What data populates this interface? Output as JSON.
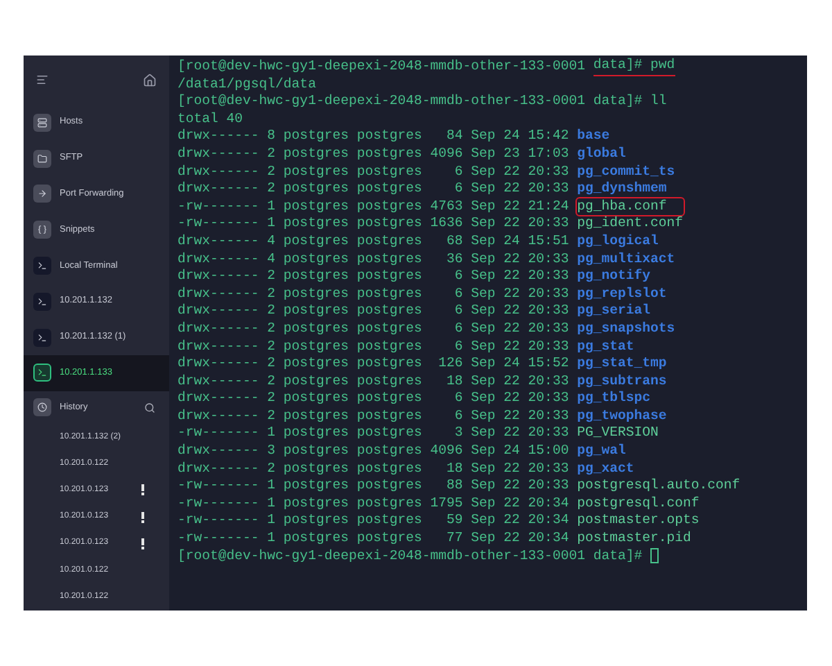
{
  "sidebar": {
    "nav": [
      {
        "label": "Hosts",
        "kind": "hosts",
        "selected": false
      },
      {
        "label": "SFTP",
        "kind": "sftp",
        "selected": false
      },
      {
        "label": "Port Forwarding",
        "kind": "forward",
        "selected": false
      },
      {
        "label": "Snippets",
        "kind": "snippets",
        "selected": false
      },
      {
        "label": "Local Terminal",
        "kind": "terminal",
        "selected": false
      },
      {
        "label": "10.201.1.132",
        "kind": "terminal",
        "selected": false
      },
      {
        "label": "10.201.1.132 (1)",
        "kind": "terminal",
        "selected": false
      },
      {
        "label": "10.201.1.133",
        "kind": "terminal",
        "selected": true
      }
    ],
    "history": {
      "label": "History",
      "items": [
        {
          "label": "10.201.1.132 (2)",
          "warning": false
        },
        {
          "label": "10.201.0.122",
          "warning": false
        },
        {
          "label": "10.201.0.123",
          "warning": true
        },
        {
          "label": "10.201.0.123",
          "warning": true
        },
        {
          "label": "10.201.0.123",
          "warning": true
        },
        {
          "label": "10.201.0.122",
          "warning": false
        },
        {
          "label": "10.201.0.122",
          "warning": false
        }
      ]
    }
  },
  "terminal": {
    "lines": [
      {
        "kind": "prompt",
        "user": "[root@dev-hwc-gy1-deepexi-2048-mmdb-other-133-0001",
        "dir": "data]#",
        "command": "pwd",
        "underlined": true,
        "cursor": false
      },
      {
        "kind": "output",
        "text": "/data1/pgsql/data"
      },
      {
        "kind": "prompt",
        "user": "[root@dev-hwc-gy1-deepexi-2048-mmdb-other-133-0001",
        "dir": "data]#",
        "command": "ll",
        "underlined": false,
        "cursor": false
      },
      {
        "kind": "output",
        "text": "total 40"
      },
      {
        "kind": "entry",
        "meta": "drwx------ 8 postgres postgres   84 Sep 24 15:42",
        "name": "base",
        "is_dir": true,
        "boxed": false
      },
      {
        "kind": "entry",
        "meta": "drwx------ 2 postgres postgres 4096 Sep 23 17:03",
        "name": "global",
        "is_dir": true,
        "boxed": false
      },
      {
        "kind": "entry",
        "meta": "drwx------ 2 postgres postgres    6 Sep 22 20:33",
        "name": "pg_commit_ts",
        "is_dir": true,
        "boxed": false
      },
      {
        "kind": "entry",
        "meta": "drwx------ 2 postgres postgres    6 Sep 22 20:33",
        "name": "pg_dynshmem",
        "is_dir": true,
        "boxed": false
      },
      {
        "kind": "entry",
        "meta": "-rw------- 1 postgres postgres 4763 Sep 22 21:24",
        "name": "pg_hba.conf",
        "is_dir": false,
        "boxed": true
      },
      {
        "kind": "entry",
        "meta": "-rw------- 1 postgres postgres 1636 Sep 22 20:33",
        "name": "pg_ident.conf",
        "is_dir": false,
        "boxed": false
      },
      {
        "kind": "entry",
        "meta": "drwx------ 4 postgres postgres   68 Sep 24 15:51",
        "name": "pg_logical",
        "is_dir": true,
        "boxed": false
      },
      {
        "kind": "entry",
        "meta": "drwx------ 4 postgres postgres   36 Sep 22 20:33",
        "name": "pg_multixact",
        "is_dir": true,
        "boxed": false
      },
      {
        "kind": "entry",
        "meta": "drwx------ 2 postgres postgres    6 Sep 22 20:33",
        "name": "pg_notify",
        "is_dir": true,
        "boxed": false
      },
      {
        "kind": "entry",
        "meta": "drwx------ 2 postgres postgres    6 Sep 22 20:33",
        "name": "pg_replslot",
        "is_dir": true,
        "boxed": false
      },
      {
        "kind": "entry",
        "meta": "drwx------ 2 postgres postgres    6 Sep 22 20:33",
        "name": "pg_serial",
        "is_dir": true,
        "boxed": false
      },
      {
        "kind": "entry",
        "meta": "drwx------ 2 postgres postgres    6 Sep 22 20:33",
        "name": "pg_snapshots",
        "is_dir": true,
        "boxed": false
      },
      {
        "kind": "entry",
        "meta": "drwx------ 2 postgres postgres    6 Sep 22 20:33",
        "name": "pg_stat",
        "is_dir": true,
        "boxed": false
      },
      {
        "kind": "entry",
        "meta": "drwx------ 2 postgres postgres  126 Sep 24 15:52",
        "name": "pg_stat_tmp",
        "is_dir": true,
        "boxed": false
      },
      {
        "kind": "entry",
        "meta": "drwx------ 2 postgres postgres   18 Sep 22 20:33",
        "name": "pg_subtrans",
        "is_dir": true,
        "boxed": false
      },
      {
        "kind": "entry",
        "meta": "drwx------ 2 postgres postgres    6 Sep 22 20:33",
        "name": "pg_tblspc",
        "is_dir": true,
        "boxed": false
      },
      {
        "kind": "entry",
        "meta": "drwx------ 2 postgres postgres    6 Sep 22 20:33",
        "name": "pg_twophase",
        "is_dir": true,
        "boxed": false
      },
      {
        "kind": "entry",
        "meta": "-rw------- 1 postgres postgres    3 Sep 22 20:33",
        "name": "PG_VERSION",
        "is_dir": false,
        "boxed": false
      },
      {
        "kind": "entry",
        "meta": "drwx------ 3 postgres postgres 4096 Sep 24 15:00",
        "name": "pg_wal",
        "is_dir": true,
        "boxed": false
      },
      {
        "kind": "entry",
        "meta": "drwx------ 2 postgres postgres   18 Sep 22 20:33",
        "name": "pg_xact",
        "is_dir": true,
        "boxed": false
      },
      {
        "kind": "entry",
        "meta": "-rw------- 1 postgres postgres   88 Sep 22 20:33",
        "name": "postgresql.auto.conf",
        "is_dir": false,
        "boxed": false
      },
      {
        "kind": "entry",
        "meta": "-rw------- 1 postgres postgres 1795 Sep 22 20:34",
        "name": "postgresql.conf",
        "is_dir": false,
        "boxed": false
      },
      {
        "kind": "entry",
        "meta": "-rw------- 1 postgres postgres   59 Sep 22 20:34",
        "name": "postmaster.opts",
        "is_dir": false,
        "boxed": false
      },
      {
        "kind": "entry",
        "meta": "-rw------- 1 postgres postgres   77 Sep 22 20:34",
        "name": "postmaster.pid",
        "is_dir": false,
        "boxed": false
      },
      {
        "kind": "prompt",
        "user": "[root@dev-hwc-gy1-deepexi-2048-mmdb-other-133-0001",
        "dir": "data]#",
        "underlined": false,
        "cursor": true
      }
    ]
  }
}
